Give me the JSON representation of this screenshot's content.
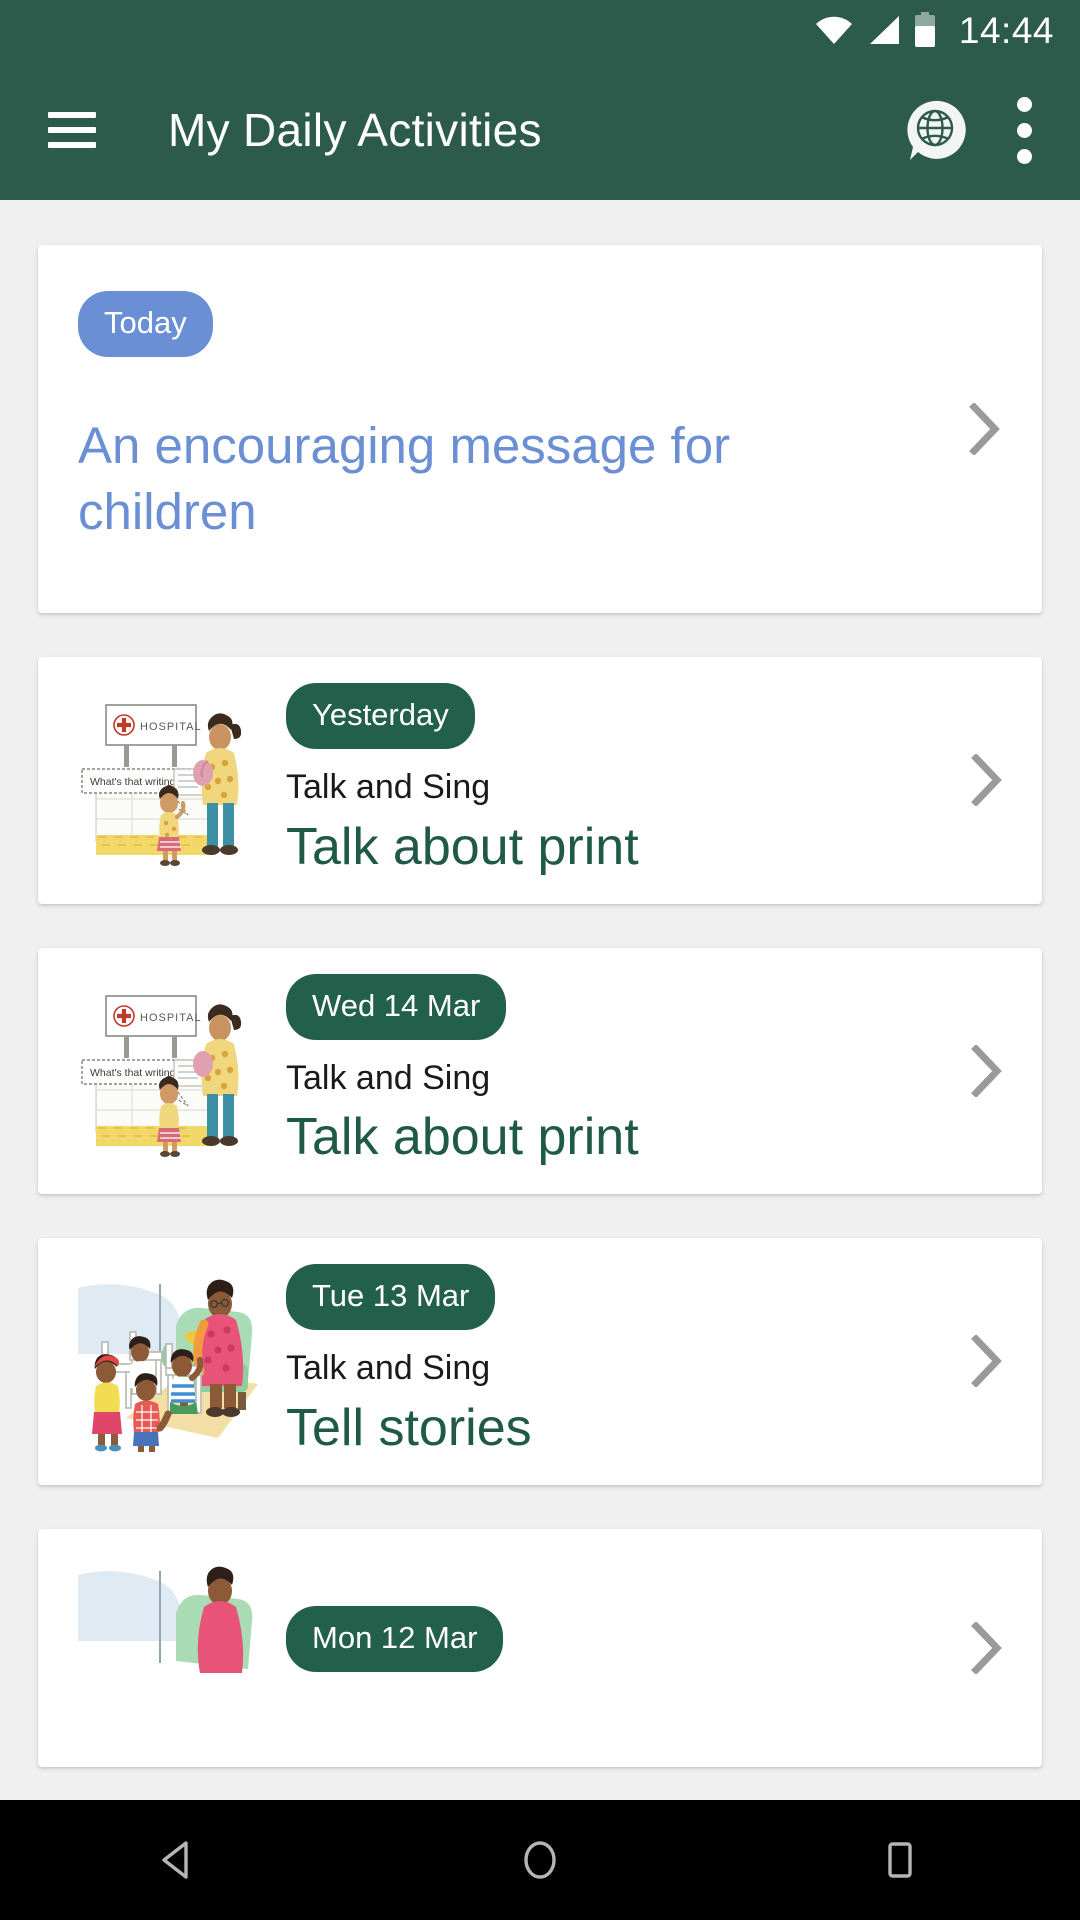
{
  "status_bar": {
    "time": "14:44",
    "icons": [
      "wifi-icon",
      "cellular-signal-icon",
      "battery-icon"
    ]
  },
  "app_bar": {
    "menu_icon": "hamburger-menu-icon",
    "title": "My Daily Activities",
    "language_icon": "globe-speech-bubble-icon",
    "overflow_icon": "overflow-menu-icon"
  },
  "colors": {
    "header_green": "#2C5A4B",
    "badge_green": "#23604C",
    "title_green": "#1F5948",
    "accent_blue": "#6B8FD4",
    "page_background": "#f0f0f0",
    "card_background": "#ffffff",
    "chevron_gray": "#9a9a9a",
    "navbar_black": "#000000"
  },
  "cards": [
    {
      "type": "message",
      "badge": "Today",
      "badge_color": "blue",
      "title": "An encouraging message for children",
      "chevron": "chevron-right-icon"
    },
    {
      "type": "activity",
      "badge": "Yesterday",
      "badge_color": "green",
      "subtitle": "Talk and Sing",
      "title": "Talk about print",
      "thumbnail": "hospital-sign-illustration",
      "chevron": "chevron-right-icon"
    },
    {
      "type": "activity",
      "badge": "Wed 14 Mar",
      "badge_color": "green",
      "subtitle": "Talk and Sing",
      "title": "Talk about print",
      "thumbnail": "hospital-sign-illustration",
      "chevron": "chevron-right-icon"
    },
    {
      "type": "activity",
      "badge": "Tue 13 Mar",
      "badge_color": "green",
      "subtitle": "Talk and Sing",
      "title": "Tell stories",
      "thumbnail": "storytelling-illustration",
      "chevron": "chevron-right-icon"
    },
    {
      "type": "activity",
      "badge": "Mon 12 Mar",
      "badge_color": "green",
      "subtitle": "",
      "title": "",
      "thumbnail": "storytelling-illustration",
      "chevron": "chevron-right-icon"
    }
  ],
  "illustration_text": {
    "hospital_sign": "HOSPITAL",
    "speech_bubble": "What's that writing say?"
  },
  "nav_bar": {
    "back": "back-triangle-icon",
    "home": "home-circle-icon",
    "recents": "recents-square-icon"
  }
}
